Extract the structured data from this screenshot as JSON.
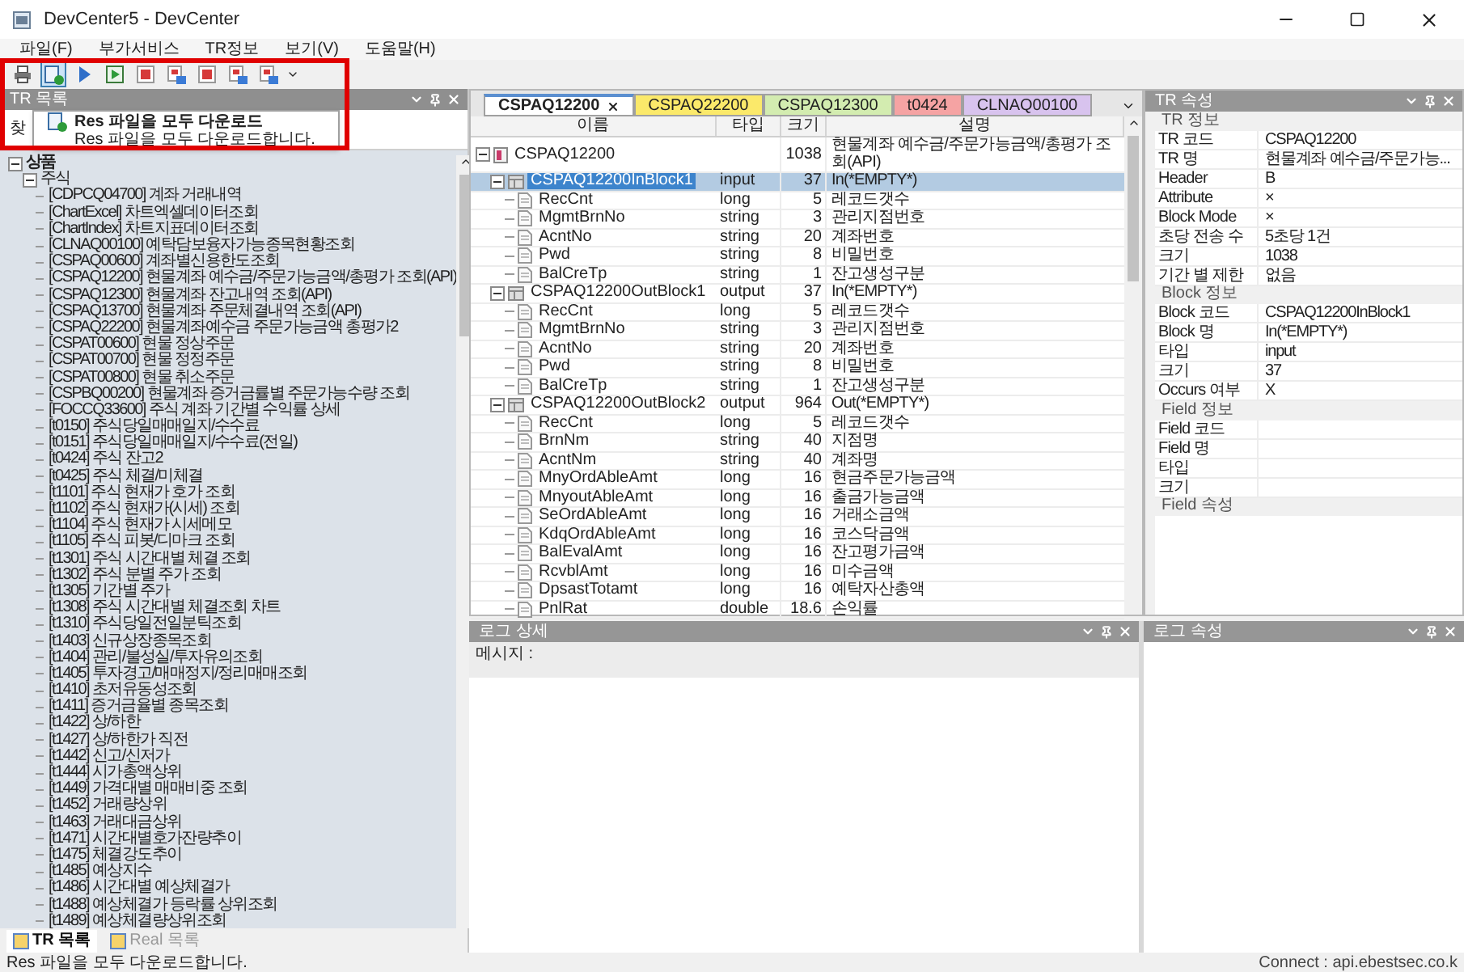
{
  "window": {
    "title": "DevCenter5 - DevCenter"
  },
  "menu": [
    "파일(F)",
    "부가서비스",
    "TR정보",
    "보기(V)",
    "도움말(H)"
  ],
  "toolbar": [
    {
      "kind": "printer",
      "selected": false
    },
    {
      "kind": "download",
      "selected": true
    },
    {
      "kind": "play",
      "selected": false
    },
    {
      "kind": "step",
      "selected": false
    },
    {
      "kind": "doc-red",
      "selected": false
    },
    {
      "kind": "doc-grid",
      "selected": false
    },
    {
      "kind": "doc-red",
      "selected": false
    },
    {
      "kind": "doc-grid",
      "selected": false
    },
    {
      "kind": "doc-grid",
      "selected": false
    }
  ],
  "tooltip": {
    "title": "Res 파일을 모두 다운로드",
    "text": "Res 파일을 모두 다운로드합니다."
  },
  "left_panel": {
    "title": "TR 목록",
    "search_label": "찾",
    "tree": [
      {
        "label": "상품",
        "expanded": true,
        "children": [
          {
            "label": "주식",
            "expanded": true,
            "children": [
              {
                "label": "[CDPCQ04700] 계좌 거래내역"
              },
              {
                "label": "[ChartExcel] 차트엑셀데이터조회"
              },
              {
                "label": "[ChartIndex] 차트지표데이터조회"
              },
              {
                "label": "[CLNAQ00100] 예탁담보융자가능종목현황조회"
              },
              {
                "label": "[CSPAQ00600] 계좌별신용한도조회"
              },
              {
                "label": "[CSPAQ12200] 현물계좌 예수금/주문가능금액/총평가 조회(API)"
              },
              {
                "label": "[CSPAQ12300] 현물계좌 잔고내역 조회(API)"
              },
              {
                "label": "[CSPAQ13700] 현물계좌 주문체결내역 조회(API)"
              },
              {
                "label": "[CSPAQ22200] 현물계좌예수금 주문가능금액 총평가2"
              },
              {
                "label": "[CSPAT00600] 현물 정상주문"
              },
              {
                "label": "[CSPAT00700] 현물 정정주문"
              },
              {
                "label": "[CSPAT00800] 현물 취소주문"
              },
              {
                "label": "[CSPBQ00200] 현물계좌 증거금률별 주문가능수량 조회"
              },
              {
                "label": "[FOCCQ33600] 주식 계좌 기간별 수익률 상세"
              },
              {
                "label": "[t0150] 주식당일매매일지/수수료"
              },
              {
                "label": "[t0151] 주식당일매매일지/수수료(전일)"
              },
              {
                "label": "[t0424] 주식 잔고2"
              },
              {
                "label": "[t0425] 주식 체결/미체결"
              },
              {
                "label": "[t1101] 주식 현재가 호가 조회"
              },
              {
                "label": "[t1102] 주식 현재가(시세) 조회"
              },
              {
                "label": "[t1104] 주식 현재가 시세메모"
              },
              {
                "label": "[t1105] 주식 피봇/디마크 조회"
              },
              {
                "label": "[t1301] 주식 시간대별 체결 조회"
              },
              {
                "label": "[t1302] 주식 분별 주가 조회"
              },
              {
                "label": "[t1305] 기간별 주가"
              },
              {
                "label": "[t1308] 주식 시간대별 체결조회 차트"
              },
              {
                "label": "[t1310] 주식당일전일분틱조회"
              },
              {
                "label": "[t1403] 신규상장종목조회"
              },
              {
                "label": "[t1404] 관리/불성실/투자유의조회"
              },
              {
                "label": "[t1405] 투자경고/매매정지/정리매매조회"
              },
              {
                "label": "[t1410] 초저유동성조회"
              },
              {
                "label": "[t1411] 증거금율별 종목조회"
              },
              {
                "label": "[t1422] 상/하한"
              },
              {
                "label": "[t1427] 상/하한가 직전"
              },
              {
                "label": "[t1442] 신고/신저가"
              },
              {
                "label": "[t1444] 시가총액상위"
              },
              {
                "label": "[t1449] 가격대별 매매비중 조회"
              },
              {
                "label": "[t1452] 거래량상위"
              },
              {
                "label": "[t1463] 거래대금상위"
              },
              {
                "label": "[t1471] 시간대별호가잔량추이"
              },
              {
                "label": "[t1475] 체결강도추이"
              },
              {
                "label": "[t1485] 예상지수"
              },
              {
                "label": "[t1486] 시간대별 예상체결가"
              },
              {
                "label": "[t1488] 예상체결가 등락률 상위조회"
              },
              {
                "label": "[t1489] 예상체결량상위조회"
              }
            ]
          }
        ]
      }
    ],
    "bottom_tabs": [
      {
        "label": "TR 목록",
        "selected": true
      },
      {
        "label": "Real 목록",
        "selected": false
      }
    ]
  },
  "doc_tabs": [
    {
      "label": "CSPAQ12200",
      "selected": true,
      "color": "#ffffff"
    },
    {
      "label": "CSPAQ22200",
      "selected": false,
      "color": "#fbe96a"
    },
    {
      "label": "CSPAQ12300",
      "selected": false,
      "color": "#d3ecb0"
    },
    {
      "label": "t0424",
      "selected": false,
      "color": "#f5a3a3"
    },
    {
      "label": "CLNAQ00100",
      "selected": false,
      "color": "#d8c3ee"
    }
  ],
  "table": {
    "columns": [
      "이름",
      "타입",
      "크기",
      "설명"
    ],
    "rows": [
      {
        "kind": "root",
        "name": "CSPAQ12200",
        "size": "1038",
        "desc": "현물계좌 예수금/주문가능금액/총평가 조회(API)",
        "expanded": true,
        "selected": false,
        "children": [
          {
            "kind": "block",
            "name": "CSPAQ12200InBlock1",
            "type": "input",
            "size": "37",
            "desc": "In(*EMPTY*)",
            "expanded": true,
            "selected": true,
            "children": [
              {
                "kind": "field",
                "name": "RecCnt",
                "type": "long",
                "size": "5",
                "desc": "레코드갯수",
                "selected": false
              },
              {
                "kind": "field",
                "name": "MgmtBrnNo",
                "type": "string",
                "size": "3",
                "desc": "관리지점번호",
                "selected": false
              },
              {
                "kind": "field",
                "name": "AcntNo",
                "type": "string",
                "size": "20",
                "desc": "계좌번호",
                "selected": false
              },
              {
                "kind": "field",
                "name": "Pwd",
                "type": "string",
                "size": "8",
                "desc": "비밀번호",
                "selected": false
              },
              {
                "kind": "field",
                "name": "BalCreTp",
                "type": "string",
                "size": "1",
                "desc": "잔고생성구분",
                "selected": false
              }
            ]
          },
          {
            "kind": "block",
            "name": "CSPAQ12200OutBlock1",
            "type": "output",
            "size": "37",
            "desc": "In(*EMPTY*)",
            "expanded": true,
            "selected": false,
            "children": [
              {
                "kind": "field",
                "name": "RecCnt",
                "type": "long",
                "size": "5",
                "desc": "레코드갯수",
                "selected": false
              },
              {
                "kind": "field",
                "name": "MgmtBrnNo",
                "type": "string",
                "size": "3",
                "desc": "관리지점번호",
                "selected": false
              },
              {
                "kind": "field",
                "name": "AcntNo",
                "type": "string",
                "size": "20",
                "desc": "계좌번호",
                "selected": false
              },
              {
                "kind": "field",
                "name": "Pwd",
                "type": "string",
                "size": "8",
                "desc": "비밀번호",
                "selected": false
              },
              {
                "kind": "field",
                "name": "BalCreTp",
                "type": "string",
                "size": "1",
                "desc": "잔고생성구분",
                "selected": false
              }
            ]
          },
          {
            "kind": "block",
            "name": "CSPAQ12200OutBlock2",
            "type": "output",
            "size": "964",
            "desc": "Out(*EMPTY*)",
            "expanded": true,
            "selected": false,
            "children": [
              {
                "kind": "field",
                "name": "RecCnt",
                "type": "long",
                "size": "5",
                "desc": "레코드갯수",
                "selected": false
              },
              {
                "kind": "field",
                "name": "BrnNm",
                "type": "string",
                "size": "40",
                "desc": "지점명",
                "selected": false
              },
              {
                "kind": "field",
                "name": "AcntNm",
                "type": "string",
                "size": "40",
                "desc": "계좌명",
                "selected": false
              },
              {
                "kind": "field",
                "name": "MnyOrdAbleAmt",
                "type": "long",
                "size": "16",
                "desc": "현금주문가능금액",
                "selected": false
              },
              {
                "kind": "field",
                "name": "MnyoutAbleAmt",
                "type": "long",
                "size": "16",
                "desc": "출금가능금액",
                "selected": false
              },
              {
                "kind": "field",
                "name": "SeOrdAbleAmt",
                "type": "long",
                "size": "16",
                "desc": "거래소금액",
                "selected": false
              },
              {
                "kind": "field",
                "name": "KdqOrdAbleAmt",
                "type": "long",
                "size": "16",
                "desc": "코스닥금액",
                "selected": false
              },
              {
                "kind": "field",
                "name": "BalEvalAmt",
                "type": "long",
                "size": "16",
                "desc": "잔고평가금액",
                "selected": false
              },
              {
                "kind": "field",
                "name": "RcvblAmt",
                "type": "long",
                "size": "16",
                "desc": "미수금액",
                "selected": false
              },
              {
                "kind": "field",
                "name": "DpsastTotamt",
                "type": "long",
                "size": "16",
                "desc": "예탁자산총액",
                "selected": false
              },
              {
                "kind": "field",
                "name": "PnlRat",
                "type": "double",
                "size": "18.6",
                "desc": "손익률",
                "selected": false
              }
            ]
          }
        ]
      }
    ]
  },
  "properties_panel": {
    "title": "TR 속성",
    "rows": [
      {
        "kind": "section",
        "label": "TR 정보"
      },
      {
        "kind": "property",
        "label": "TR 코드",
        "value": "CSPAQ12200"
      },
      {
        "kind": "property",
        "label": "TR 명",
        "value": "현물계좌 예수금/주문가능..."
      },
      {
        "kind": "property",
        "label": "Header",
        "value": "B"
      },
      {
        "kind": "property",
        "label": "Attribute",
        "value": "×"
      },
      {
        "kind": "property",
        "label": "Block Mode",
        "value": "×"
      },
      {
        "kind": "property",
        "label": "초당 전송 수",
        "value": "5초당 1건"
      },
      {
        "kind": "property",
        "label": "크기",
        "value": "1038"
      },
      {
        "kind": "property",
        "label": "기간 별 제한",
        "value": "없음"
      },
      {
        "kind": "section",
        "label": "Block 정보"
      },
      {
        "kind": "property",
        "label": "Block 코드",
        "value": "CSPAQ12200InBlock1"
      },
      {
        "kind": "property",
        "label": "Block 명",
        "value": "In(*EMPTY*)"
      },
      {
        "kind": "property",
        "label": "타입",
        "value": "input"
      },
      {
        "kind": "property",
        "label": "크기",
        "value": "37"
      },
      {
        "kind": "property",
        "label": "Occurs 여부",
        "value": "X"
      },
      {
        "kind": "section",
        "label": "Field 정보"
      },
      {
        "kind": "property",
        "label": "Field 코드"
      },
      {
        "kind": "property",
        "label": "Field 명"
      },
      {
        "kind": "property",
        "label": "타입"
      },
      {
        "kind": "property",
        "label": "크기"
      },
      {
        "kind": "section",
        "label": "Field 속성"
      }
    ]
  },
  "log_detail": {
    "title": "로그 상세",
    "message_label": "메시지 :"
  },
  "log_properties": {
    "title": "로그 속성"
  },
  "status_bar": {
    "message": "Res 파일을 모두 다운로드합니다.",
    "connection": "Connect : api.ebestsec.co.k"
  }
}
